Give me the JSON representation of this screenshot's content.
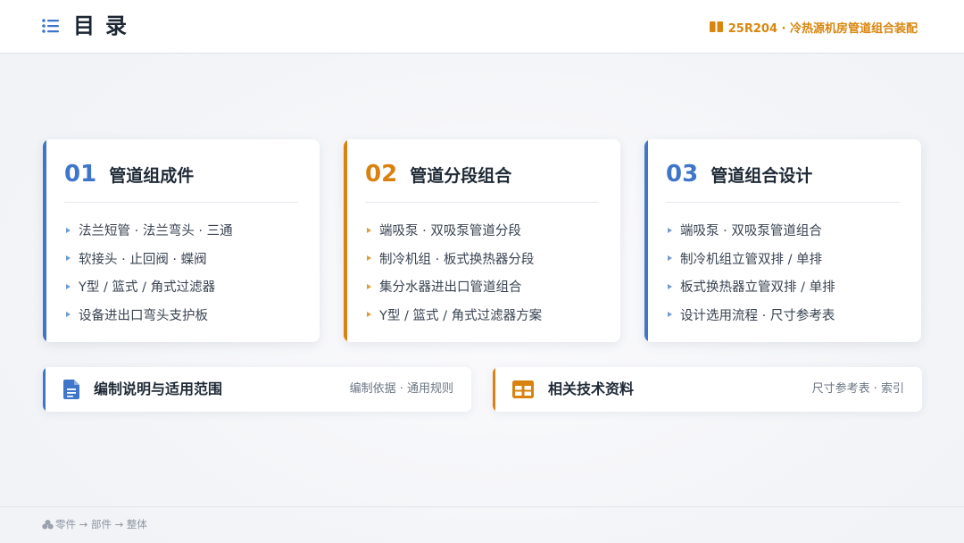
{
  "header": {
    "title": "目录",
    "doc_code": "25R204 · 冷热源机房管道组合装配"
  },
  "colors": {
    "blue": "#3f76c9",
    "orange": "#d9820f"
  },
  "cards": [
    {
      "num": "01",
      "name": "管道组成件",
      "items": [
        "法兰短管 · 法兰弯头 · 三通",
        "软接头 · 止回阀 · 蝶阀",
        "Y型 / 篮式 / 角式过滤器",
        "设备进出口弯头支护板"
      ]
    },
    {
      "num": "02",
      "name": "管道分段组合",
      "items": [
        "端吸泵 · 双吸泵管道分段",
        "制冷机组 · 板式换热器分段",
        "集分水器进出口管道组合",
        "Y型 / 篮式 / 角式过滤器方案"
      ]
    },
    {
      "num": "03",
      "name": "管道组合设计",
      "items": [
        "端吸泵 · 双吸泵管道组合",
        "制冷机组立管双排 / 单排",
        "板式换热器立管双排 / 单排",
        "设计选用流程 · 尺寸参考表"
      ]
    }
  ],
  "strips": [
    {
      "title": "编制说明与适用范围",
      "note": "编制依据 · 通用规则",
      "icon": "document-icon"
    },
    {
      "title": "相关技术资料",
      "note": "尺寸参考表 · 索引",
      "icon": "table-icon"
    }
  ],
  "footer": {
    "text": "零件 → 部件 → 整体"
  }
}
